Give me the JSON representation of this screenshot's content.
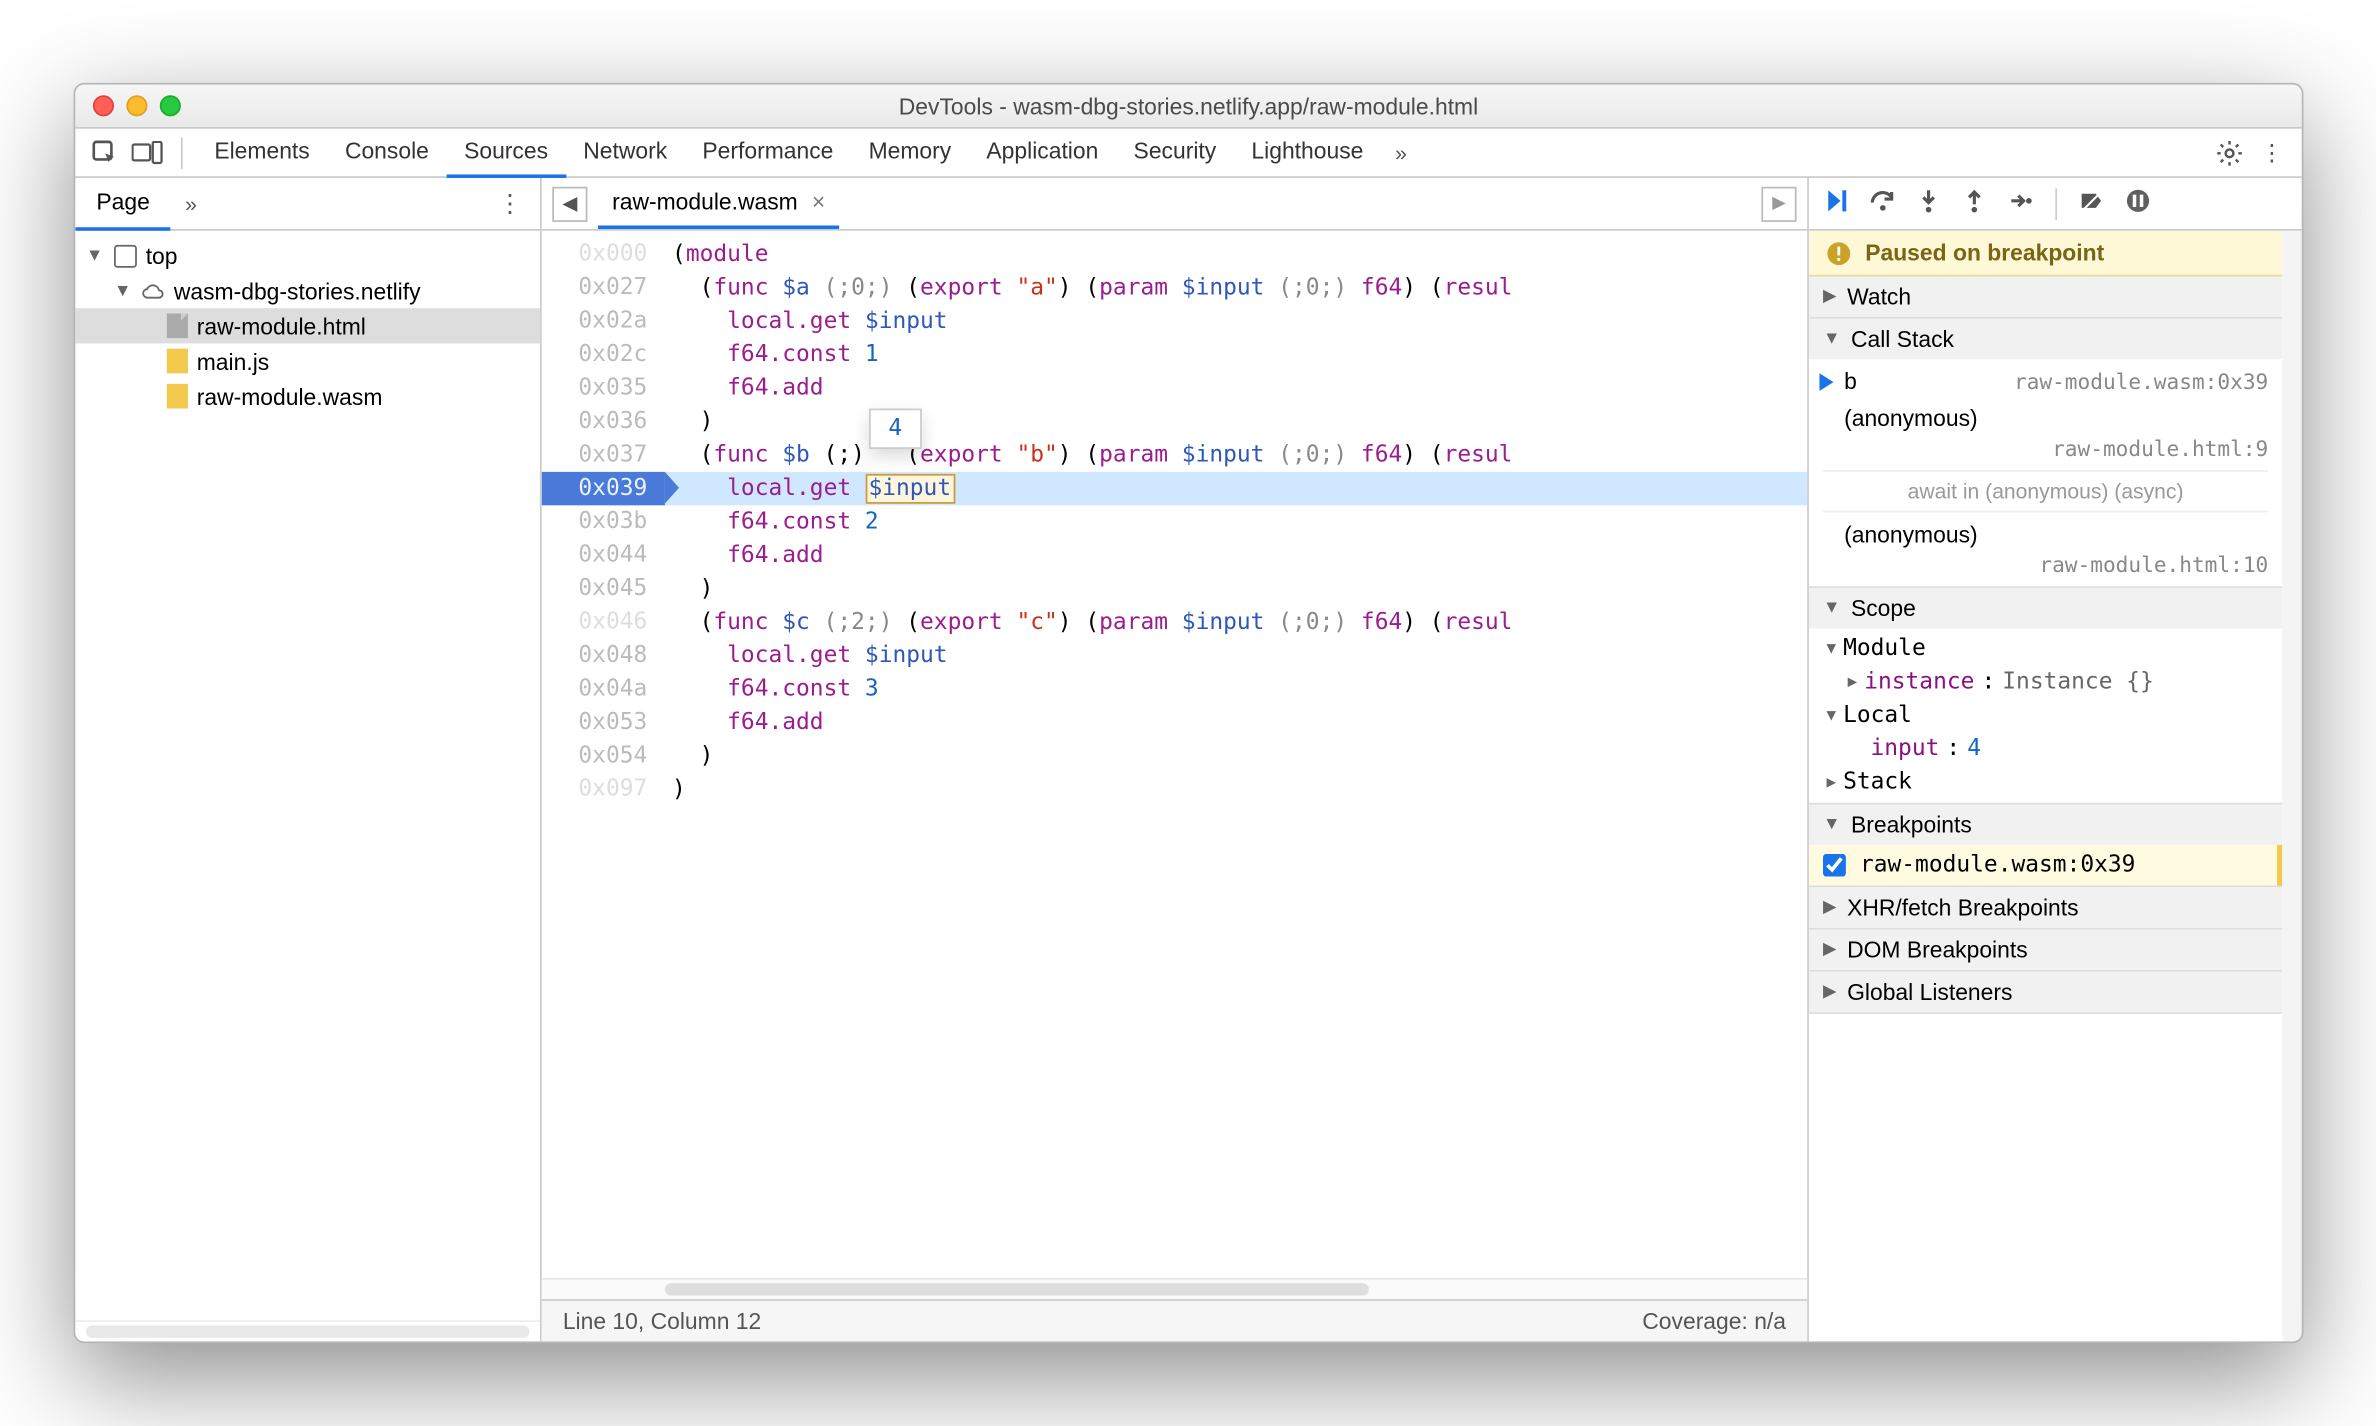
{
  "title": "DevTools - wasm-dbg-stories.netlify.app/raw-module.html",
  "tabs": [
    "Elements",
    "Console",
    "Sources",
    "Network",
    "Performance",
    "Memory",
    "Application",
    "Security",
    "Lighthouse"
  ],
  "active_tab": "Sources",
  "page_panel": {
    "tab_label": "Page",
    "tree": {
      "root": "top",
      "domain": "wasm-dbg-stories.netlify",
      "files": [
        "raw-module.html",
        "main.js",
        "raw-module.wasm"
      ],
      "selected": "raw-module.html"
    }
  },
  "editor": {
    "filename": "raw-module.wasm",
    "hover_value": "4",
    "highlighted_offset": "0x039",
    "highlighted_token": "$input",
    "lines": [
      {
        "off": "0x000",
        "t": [
          "(",
          "kw:module"
        ]
      },
      {
        "off": "0x027",
        "t": [
          "  (",
          "kw:func",
          " ",
          "name:$a",
          " ",
          "comment:(;0;)",
          " (",
          "kw:export",
          " ",
          "str:\"a\"",
          ") (",
          "kw:param",
          " ",
          "name:$input",
          " ",
          "comment:(;0;)",
          " ",
          "kw:f64",
          ") (",
          "kw:resul"
        ]
      },
      {
        "off": "0x02a",
        "t": [
          "    ",
          "kw:local.get",
          " ",
          "name:$input"
        ]
      },
      {
        "off": "0x02c",
        "t": [
          "    ",
          "kw:f64.const",
          " ",
          "num:1"
        ]
      },
      {
        "off": "0x035",
        "t": [
          "    ",
          "kw:f64.add"
        ]
      },
      {
        "off": "0x036",
        "t": [
          "  )"
        ]
      },
      {
        "off": "0x037",
        "t": [
          "  (",
          "kw:func",
          " ",
          "name:$b",
          " (;",
          ")   (",
          "kw:export",
          " ",
          "str:\"b\"",
          ") (",
          "kw:param",
          " ",
          "name:$input",
          " ",
          "comment:(;0;)",
          " ",
          "kw:f64",
          ") (",
          "kw:resul"
        ]
      },
      {
        "off": "0x039",
        "t": [
          "    ",
          "kw:local.get",
          " ",
          "boxname:$input"
        ]
      },
      {
        "off": "0x03b",
        "t": [
          "    ",
          "kw:f64.const",
          " ",
          "num:2"
        ]
      },
      {
        "off": "0x044",
        "t": [
          "    ",
          "kw:f64.add"
        ]
      },
      {
        "off": "0x045",
        "t": [
          "  )"
        ]
      },
      {
        "off": "0x046",
        "t": [
          "  (",
          "kw:func",
          " ",
          "name:$c",
          " ",
          "comment:(;2;)",
          " (",
          "kw:export",
          " ",
          "str:\"c\"",
          ") (",
          "kw:param",
          " ",
          "name:$input",
          " ",
          "comment:(;0;)",
          " ",
          "kw:f64",
          ") (",
          "kw:resul"
        ]
      },
      {
        "off": "0x048",
        "t": [
          "    ",
          "kw:local.get",
          " ",
          "name:$input"
        ]
      },
      {
        "off": "0x04a",
        "t": [
          "    ",
          "kw:f64.const",
          " ",
          "num:3"
        ]
      },
      {
        "off": "0x053",
        "t": [
          "    ",
          "kw:f64.add"
        ]
      },
      {
        "off": "0x054",
        "t": [
          "  )"
        ]
      },
      {
        "off": "0x097",
        "t": [
          ")"
        ]
      }
    ],
    "status_left": "Line 10, Column 12",
    "status_right": "Coverage: n/a"
  },
  "debugger": {
    "banner": "Paused on breakpoint",
    "sections": {
      "watch": "Watch",
      "callstack": "Call Stack",
      "scope": "Scope",
      "breakpoints": "Breakpoints",
      "xhr": "XHR/fetch Breakpoints",
      "dom": "DOM Breakpoints",
      "global": "Global Listeners"
    },
    "callstack": [
      {
        "fn": "b",
        "loc": "raw-module.wasm:0x39",
        "current": true
      },
      {
        "fn": "(anonymous)",
        "loc": "raw-module.html:9"
      }
    ],
    "await_label": "await in (anonymous) (async)",
    "callstack2": [
      {
        "fn": "(anonymous)",
        "loc": "raw-module.html:10"
      }
    ],
    "scope": {
      "module_label": "Module",
      "instance_label": "instance",
      "instance_value": "Instance {}",
      "local_label": "Local",
      "input_label": "input",
      "input_value": "4",
      "stack_label": "Stack"
    },
    "breakpoint": "raw-module.wasm:0x39"
  }
}
